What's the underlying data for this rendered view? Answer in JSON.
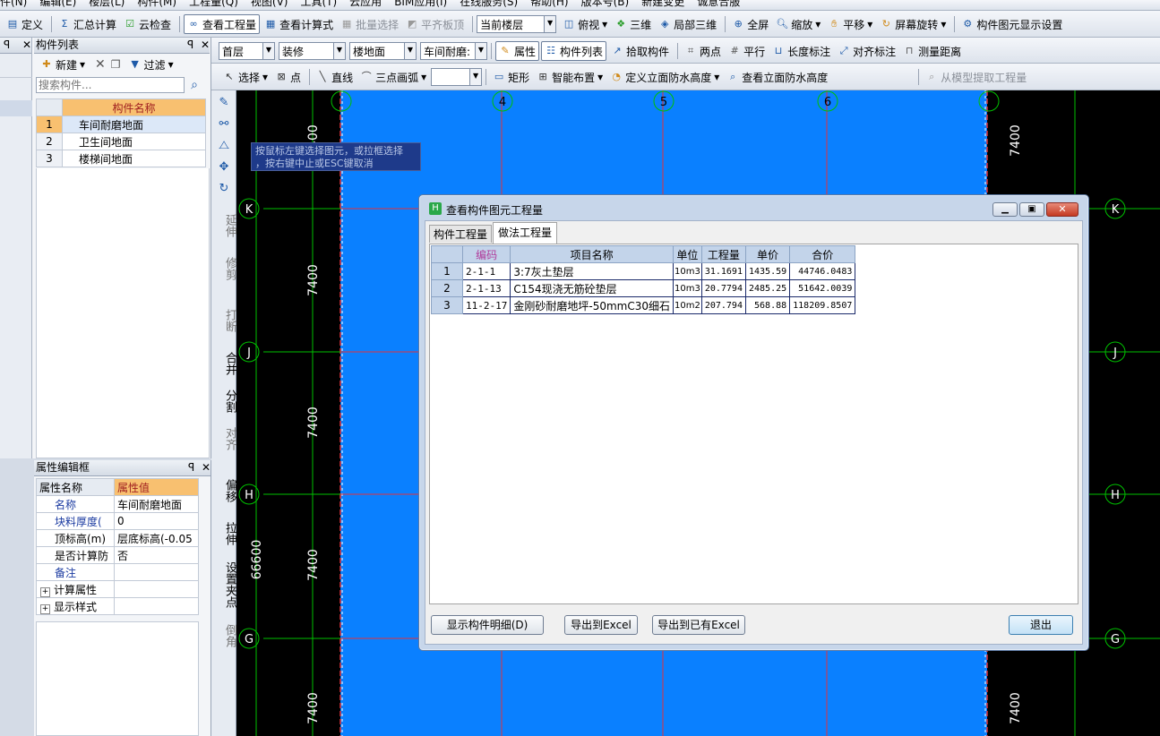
{
  "menu": {
    "items": [
      "件(N)",
      "编辑(E)",
      "楼层(L)",
      "构件(M)",
      "工程量(Q)",
      "视图(V)",
      "工具(T)",
      "云应用",
      "BIM应用(I)",
      "在线服务(S)",
      "帮助(H)",
      "版本号(B)",
      "新建变更",
      "诚意合服"
    ]
  },
  "toolbar1": {
    "define": "定义",
    "sum_calc": "汇总计算",
    "cloud_check": "云检查",
    "view_qty": "查看工程量",
    "view_formula": "查看计算式",
    "batch_select": "批量选择",
    "flat_board": "平齐板顶",
    "current_floor": "当前楼层",
    "top_view": "俯视",
    "three_d": "三维",
    "local_3d": "局部三维",
    "fullscreen": "全屏",
    "zoom": "缩放",
    "pan": "平移",
    "screen_rotate": "屏幕旋转",
    "display_settings": "构件图元显示设置"
  },
  "toolbar2": {
    "floor": "首层",
    "category": "装修",
    "type": "楼地面",
    "component": "车间耐磨:",
    "props": "属性",
    "comp_list": "构件列表",
    "pick": "拾取构件",
    "two_point": "两点",
    "parallel": "平行",
    "length_dim": "长度标注",
    "align_dim": "对齐标注",
    "measure": "测量距离"
  },
  "toolbar3": {
    "select": "选择",
    "point": "点",
    "line": "直线",
    "arc3": "三点画弧",
    "rect": "矩形",
    "smart": "智能布置",
    "def_wp": "定义立面防水高度",
    "view_wp": "查看立面防水高度",
    "extract": "从模型提取工程量"
  },
  "component_panel": {
    "title": "构件列表",
    "new": "新建",
    "filter": "过滤",
    "search_placeholder": "搜索构件...",
    "column": "构件名称",
    "rows": [
      {
        "no": "1",
        "name": "车间耐磨地面"
      },
      {
        "no": "2",
        "name": "卫生间地面"
      },
      {
        "no": "3",
        "name": "楼梯间地面"
      }
    ]
  },
  "property_panel": {
    "title": "属性编辑框",
    "col_name": "属性名称",
    "col_value": "属性值",
    "rows": [
      {
        "name": "名称",
        "value": "车间耐磨地面"
      },
      {
        "name": "块料厚度(",
        "value": "0"
      },
      {
        "name": "顶标高(m)",
        "value": "层底标高(-0.05"
      },
      {
        "name": "是否计算防",
        "value": "否"
      },
      {
        "name": "备注",
        "value": ""
      },
      {
        "name": "计算属性",
        "value": ""
      },
      {
        "name": "显示样式",
        "value": ""
      }
    ]
  },
  "vertical_tools": [
    "延伸",
    "修剪",
    "打断",
    "合并",
    "分割",
    "对齐",
    "偏移",
    "拉伸",
    "设置夹点",
    "倒角"
  ],
  "canvas": {
    "tooltip_line1": "按鼠标左键选择图元，或拉框选择",
    "tooltip_line2": "，按右键中止或ESC键取消",
    "axis_top": [
      "4",
      "5",
      "6",
      "7"
    ],
    "axis_side": [
      "K",
      "J",
      "H",
      "G"
    ],
    "dim_left": [
      "7400",
      "7400",
      "7400",
      "7400",
      "7400",
      "7400"
    ],
    "dim_total": "66600",
    "dim_right": [
      "7400",
      "7400"
    ]
  },
  "dialog": {
    "title": "查看构件图元工程量",
    "tab_component": "构件工程量",
    "tab_method": "做法工程量",
    "columns": [
      "编码",
      "项目名称",
      "单位",
      "工程量",
      "单价",
      "合价"
    ],
    "rows": [
      {
        "no": "1",
        "code": "2-1-1",
        "name": "3:7灰土垫层",
        "unit": "10m3",
        "qty": "31.1691",
        "price": "1435.59",
        "total": "44746.0483"
      },
      {
        "no": "2",
        "code": "2-1-13",
        "name": "C154现浇无筋砼垫层",
        "unit": "10m3",
        "qty": "20.7794",
        "price": "2485.25",
        "total": "51642.0039"
      },
      {
        "no": "3",
        "code": "11-2-17",
        "name": "金刚砂耐磨地坪-50mmC30细石",
        "unit": "10m2",
        "qty": "207.794",
        "price": "568.88",
        "total": "118209.8507"
      }
    ],
    "btn_detail": "显示构件明细(D)",
    "btn_export": "导出到Excel",
    "btn_export_existing": "导出到已有Excel",
    "btn_exit": "退出"
  },
  "colors": {
    "canvas_blue": "#0a80ff",
    "axis_green": "#00c000",
    "grid_red": "#e0323c",
    "selected_row": "#dce8f8",
    "header_orange": "#f8c070"
  }
}
